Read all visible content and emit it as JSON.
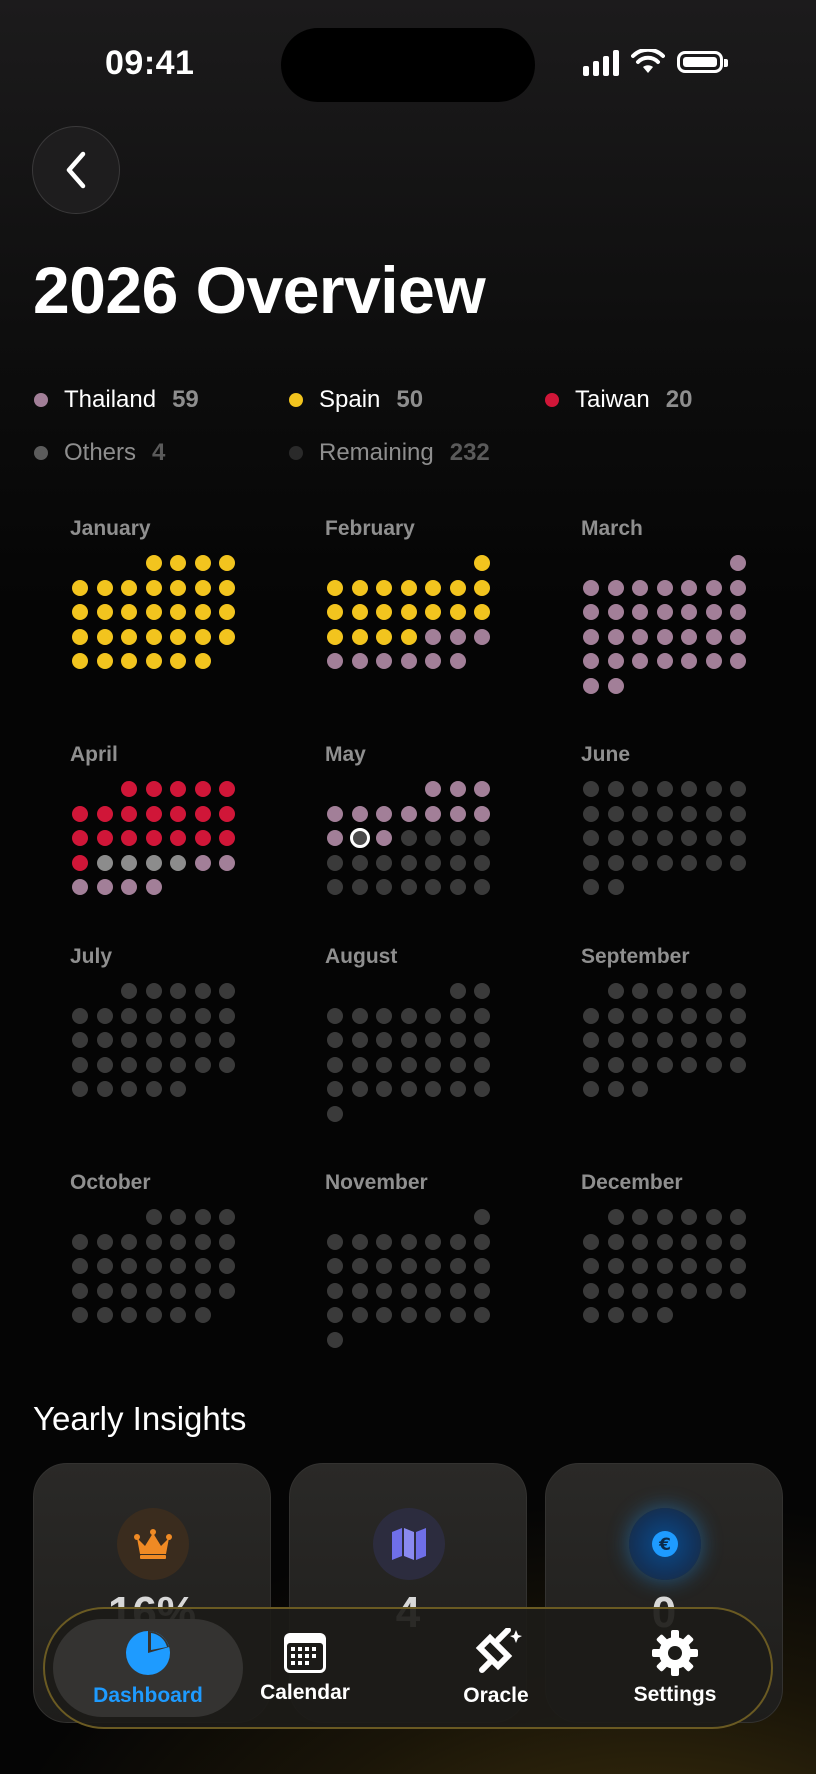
{
  "status_bar": {
    "time": "09:41"
  },
  "page": {
    "title": "2026 Overview"
  },
  "legend": [
    {
      "name": "Thailand",
      "count": "59",
      "color": "#a27f98"
    },
    {
      "name": "Spain",
      "count": "50",
      "color": "#f2c41e"
    },
    {
      "name": "Taiwan",
      "count": "20",
      "color": "#d01638"
    },
    {
      "name": "Others",
      "count": "4",
      "color": "#8c8c8c"
    },
    {
      "name": "Remaining",
      "count": "232",
      "color": "#3a3a3a"
    }
  ],
  "colors": {
    "thailand": "#a27f98",
    "spain": "#f2c41e",
    "taiwan": "#d01638",
    "others": "#8c8c8c",
    "remaining": "#3a3a3a",
    "accent": "#1e9bff"
  },
  "months": [
    {
      "name": "January",
      "first_weekday": 3,
      "days": 31,
      "days_by_country": [
        {
          "country": "spain",
          "count": 31
        }
      ]
    },
    {
      "name": "February",
      "first_weekday": 6,
      "days": 28,
      "days_by_country": [
        {
          "country": "spain",
          "count": 19
        },
        {
          "country": "thailand",
          "count": 9
        }
      ]
    },
    {
      "name": "March",
      "first_weekday": 6,
      "days": 31,
      "days_by_country": [
        {
          "country": "thailand",
          "count": 31
        }
      ]
    },
    {
      "name": "April",
      "first_weekday": 2,
      "days": 30,
      "days_by_country": [
        {
          "country": "taiwan",
          "count": 20
        },
        {
          "country": "others",
          "count": 4
        },
        {
          "country": "thailand",
          "count": 6
        }
      ]
    },
    {
      "name": "May",
      "first_weekday": 4,
      "days": 31,
      "today": 12,
      "days_by_country": [
        {
          "country": "thailand",
          "count": 13
        }
      ]
    },
    {
      "name": "June",
      "first_weekday": 0,
      "days": 30,
      "days_by_country": []
    },
    {
      "name": "July",
      "first_weekday": 2,
      "days": 31,
      "days_by_country": []
    },
    {
      "name": "August",
      "first_weekday": 5,
      "days": 31,
      "days_by_country": []
    },
    {
      "name": "September",
      "first_weekday": 1,
      "days": 30,
      "days_by_country": []
    },
    {
      "name": "October",
      "first_weekday": 3,
      "days": 31,
      "days_by_country": []
    },
    {
      "name": "November",
      "first_weekday": 6,
      "days": 30,
      "days_by_country": []
    },
    {
      "name": "December",
      "first_weekday": 1,
      "days": 31,
      "days_by_country": []
    }
  ],
  "insights": {
    "title": "Yearly Insights",
    "cards": [
      {
        "icon": "crown-icon",
        "value": "16%",
        "icon_color": "#f08a24"
      },
      {
        "icon": "map-icon",
        "value": "4",
        "icon_color": "#6f6fe8"
      },
      {
        "icon": "euro-icon",
        "value": "0",
        "icon_color": "#1e9bff"
      }
    ]
  },
  "tabbar": {
    "tabs": [
      {
        "label": "Dashboard",
        "icon": "pie-chart-icon",
        "active": true
      },
      {
        "label": "Calendar",
        "icon": "calendar-icon"
      },
      {
        "label": "Oracle",
        "icon": "oracle-icon"
      },
      {
        "label": "Settings",
        "icon": "gear-icon"
      }
    ]
  }
}
